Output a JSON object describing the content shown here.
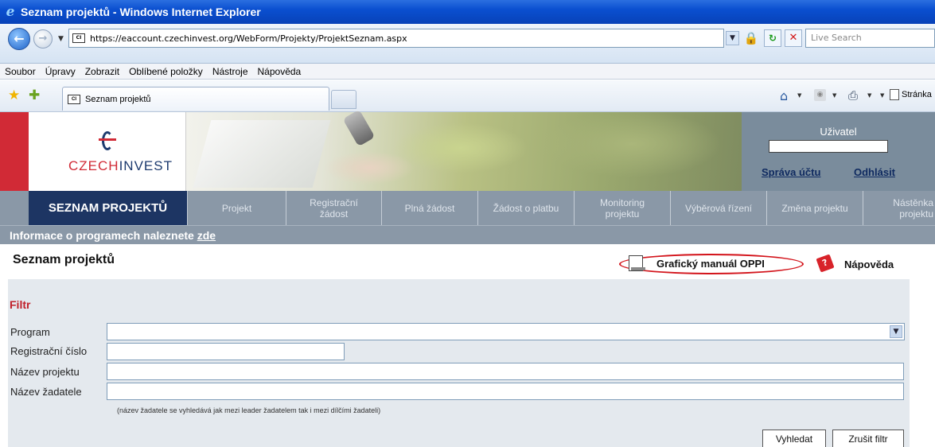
{
  "window": {
    "title": "Seznam projektů - Windows Internet Explorer"
  },
  "address": {
    "url": "https://eaccount.czechinvest.org/WebForm/Projekty/ProjektSeznam.aspx",
    "search_placeholder": "Live Search"
  },
  "menu": [
    "Soubor",
    "Úpravy",
    "Zobrazit",
    "Oblíbené položky",
    "Nástroje",
    "Nápověda"
  ],
  "tabs": {
    "active_label": "Seznam projektů"
  },
  "commandbar": {
    "page_label": "Stránka"
  },
  "site": {
    "logo_czech": "CZECH",
    "logo_invest": "INVEST",
    "user_label": "Uživatel",
    "account_link": "Správa účtu",
    "logout_link": "Odhlásit"
  },
  "nav": {
    "active": "SEZNAM PROJEKTŮ",
    "items": [
      {
        "line1": "Projekt",
        "line2": ""
      },
      {
        "line1": "Registrační",
        "line2": "žádost"
      },
      {
        "line1": "Plná žádost",
        "line2": ""
      },
      {
        "line1": "Žádost o platbu",
        "line2": ""
      },
      {
        "line1": "Monitoring",
        "line2": "projektu"
      },
      {
        "line1": "Výběrová řízení",
        "line2": ""
      },
      {
        "line1": "Změna projektu",
        "line2": ""
      },
      {
        "line1": "Nástěnka",
        "line2": "projektu"
      }
    ]
  },
  "info": {
    "text": "Informace o programech naleznete ",
    "link": "zde"
  },
  "content": {
    "title": "Seznam projektů",
    "manual_link": "Grafický manuál OPPI",
    "help_link": "Nápověda"
  },
  "filter": {
    "title": "Filtr",
    "program_label": "Program",
    "program_value": "",
    "reg_label": "Registrační číslo",
    "reg_value": "",
    "name_label": "Název projektu",
    "name_value": "",
    "applicant_label": "Název žadatele",
    "applicant_value": "",
    "hint": "(název žadatele se vyhledává jak mezi leader žadatelem tak i mezi dílčími žadateli)",
    "search_button": "Vyhledat",
    "clear_button": "Zrušit filtr"
  },
  "colors": {
    "nav_active": "#1d3563",
    "nav_bg": "#8a98a7",
    "brand_red": "#d12a36",
    "filter_title": "#c0202a",
    "highlight_ellipse": "#d3141b"
  }
}
